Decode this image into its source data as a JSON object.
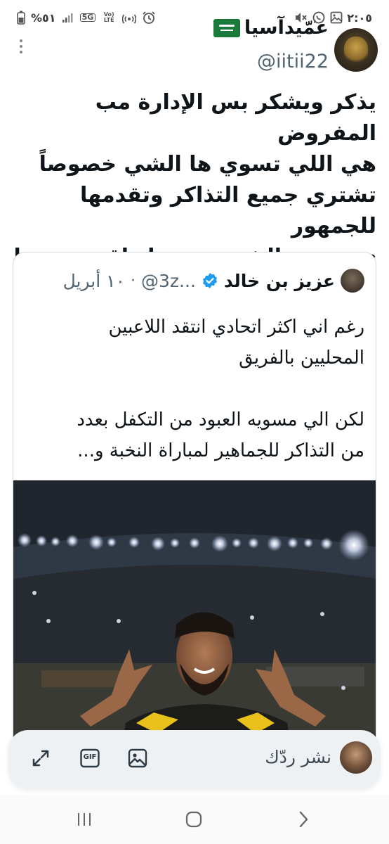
{
  "status_bar": {
    "time": "٢:٠٥",
    "battery_percent": "%٥١",
    "network_label": "5G",
    "volte_label": "Vo) LTE"
  },
  "tweet": {
    "display_name": "عمّيدآسيا",
    "handle": "@iitii22",
    "text": "يذكر ويشكر بس الإدارة مب المفروض\nهي اللي تسوي ها الشي خصوصاً\nتشتري جميع التذاكر وتقدمها للجمهور\nي سندي الشخصنه معك اقتربت جدا\nجدا"
  },
  "quoted_tweet": {
    "display_name": "عزيز بن خالد",
    "handle": "@3z...",
    "separator": "·",
    "date": "١٠ أبريل",
    "text": "رغم اني اكثر اتحادي انتقد اللاعبين\nالمحليين بالفريق\n\nلكن الي مسويه العبود من التكفل بعدد\nمن التذاكر للجماهير لمباراة النخبة و..."
  },
  "composer": {
    "placeholder": "نشر ردّك",
    "gif_label": "GIF"
  },
  "icons": {
    "status": [
      "alarm-icon",
      "hotspot-icon",
      "signal-icon",
      "battery-icon",
      "image-icon",
      "whatsapp-icon",
      "mute-icon"
    ],
    "composer": [
      "expand-icon",
      "gif-icon",
      "image-icon"
    ],
    "nav": [
      "recents-icon",
      "home-icon",
      "back-icon"
    ]
  },
  "colors": {
    "text_primary": "#0f1419",
    "text_secondary": "#536471",
    "verified_blue": "#1d9bf0",
    "card_border": "#cfd9de",
    "composer_bg": "#eef1f4",
    "flag_green": "#1a7a3c"
  }
}
